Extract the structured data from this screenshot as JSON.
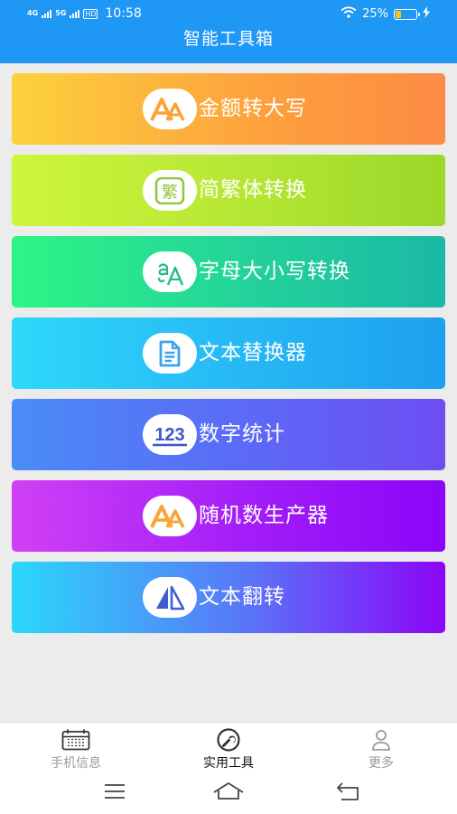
{
  "status_bar": {
    "signal1": "4G",
    "signal2": "5G",
    "hd": "HD",
    "time": "10:58",
    "battery_text": "25%",
    "battery_level": 0.25
  },
  "header": {
    "title": "智能工具箱"
  },
  "tools": [
    {
      "label": "金额转大写",
      "icon": "font-aa-icon",
      "color": "#fd9f3d"
    },
    {
      "label": "简繁体转换",
      "icon": "traditional-char-icon",
      "color": "#b5e634"
    },
    {
      "label": "字母大小写转换",
      "icon": "letter-case-icon",
      "color": "#23d29a"
    },
    {
      "label": "文本替换器",
      "icon": "document-icon",
      "color": "#26b7f4"
    },
    {
      "label": "数字统计",
      "icon": "number-123-icon",
      "color": "#5a6cf6"
    },
    {
      "label": "随机数生产器",
      "icon": "font-aa-icon",
      "color": "#a21df7"
    },
    {
      "label": "文本翻转",
      "icon": "flip-icon",
      "color": "#5a74f7"
    }
  ],
  "traditional_char_glyph": "繁",
  "numbers_glyph": "123",
  "tabbar": {
    "tabs": [
      {
        "label": "手机信息",
        "icon": "calendar-icon",
        "active": false
      },
      {
        "label": "实用工具",
        "icon": "wrench-icon",
        "active": true
      },
      {
        "label": "更多",
        "icon": "person-icon",
        "active": false
      }
    ]
  }
}
